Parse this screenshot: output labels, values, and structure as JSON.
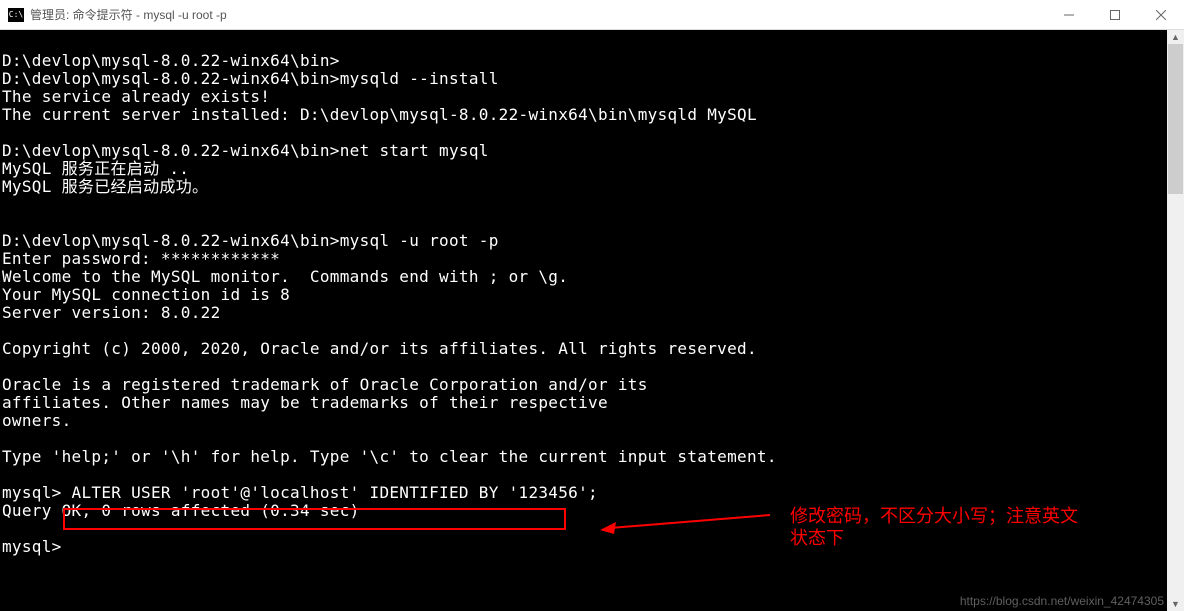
{
  "titlebar": {
    "icon_text": "C:\\",
    "title": "管理员: 命令提示符 - mysql  -u root -p"
  },
  "terminal": {
    "lines": [
      "",
      "D:\\devlop\\mysql-8.0.22-winx64\\bin>",
      "D:\\devlop\\mysql-8.0.22-winx64\\bin>mysqld --install",
      "The service already exists!",
      "The current server installed: D:\\devlop\\mysql-8.0.22-winx64\\bin\\mysqld MySQL",
      "",
      "D:\\devlop\\mysql-8.0.22-winx64\\bin>net start mysql",
      "MySQL 服务正在启动 ..",
      "MySQL 服务已经启动成功。",
      "",
      "",
      "D:\\devlop\\mysql-8.0.22-winx64\\bin>mysql -u root -p",
      "Enter password: ************",
      "Welcome to the MySQL monitor.  Commands end with ; or \\g.",
      "Your MySQL connection id is 8",
      "Server version: 8.0.22",
      "",
      "Copyright (c) 2000, 2020, Oracle and/or its affiliates. All rights reserved.",
      "",
      "Oracle is a registered trademark of Oracle Corporation and/or its",
      "affiliates. Other names may be trademarks of their respective",
      "owners.",
      "",
      "Type 'help;' or '\\h' for help. Type '\\c' to clear the current input statement.",
      "",
      "mysql> ALTER USER 'root'@'localhost' IDENTIFIED BY '123456';",
      "Query OK, 0 rows affected (0.34 sec)",
      "",
      "mysql>"
    ]
  },
  "highlight": {
    "command": "ALTER USER 'root'@'localhost' IDENTIFIED BY '123456';"
  },
  "annotation": {
    "line1": "修改密码，不区分大小写；注意英文",
    "line2": "状态下"
  },
  "watermark": "https://blog.csdn.net/weixin_42474305"
}
